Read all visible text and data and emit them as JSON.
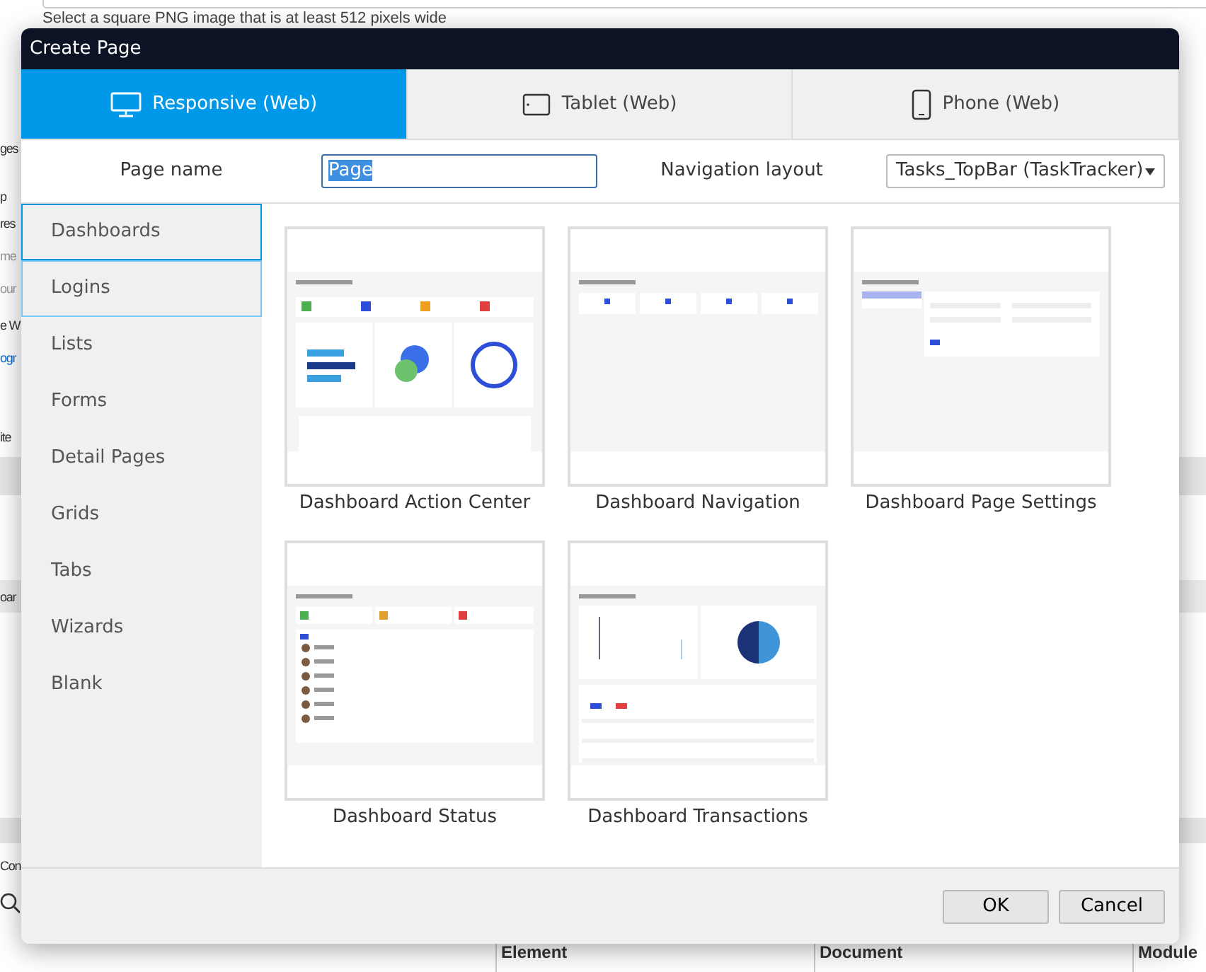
{
  "background": {
    "hint": "Select a square PNG image that is at least 512 pixels wide",
    "fragments": [
      {
        "text": "ges",
        "kind": "text"
      },
      {
        "text": "p",
        "kind": "text"
      },
      {
        "text": "res",
        "kind": "text"
      },
      {
        "text": "me",
        "kind": "muted"
      },
      {
        "text": "our",
        "kind": "muted"
      },
      {
        "text": "e W",
        "kind": "text"
      },
      {
        "text": "ogr",
        "kind": "link"
      },
      {
        "text": "ite",
        "kind": "text"
      },
      {
        "text": "oar",
        "kind": "text"
      },
      {
        "text": "Con",
        "kind": "text"
      }
    ],
    "columns": [
      "Element",
      "Document",
      "Module"
    ]
  },
  "dialog": {
    "title": "Create Page",
    "tabs": [
      {
        "label": "Responsive (Web)",
        "kind": "desktop",
        "selected": true
      },
      {
        "label": "Tablet (Web)",
        "kind": "tablet",
        "selected": false
      },
      {
        "label": "Phone (Web)",
        "kind": "phone",
        "selected": false
      }
    ],
    "form": {
      "page_name_label": "Page name",
      "page_name": {
        "value": "Page",
        "text_selected": true
      },
      "navigation_label": "Navigation layout",
      "navigation_layout": "Tasks_TopBar (TaskTracker)"
    },
    "categories": [
      {
        "label": "Dashboards",
        "selected": true,
        "hovered": false
      },
      {
        "label": "Logins",
        "selected": false,
        "hovered": true
      },
      {
        "label": "Lists",
        "selected": false,
        "hovered": false
      },
      {
        "label": "Forms",
        "selected": false,
        "hovered": false
      },
      {
        "label": "Detail Pages",
        "selected": false,
        "hovered": false
      },
      {
        "label": "Grids",
        "selected": false,
        "hovered": false
      },
      {
        "label": "Tabs",
        "selected": false,
        "hovered": false
      },
      {
        "label": "Wizards",
        "selected": false,
        "hovered": false
      },
      {
        "label": "Blank",
        "selected": false,
        "hovered": false
      }
    ],
    "templates": [
      {
        "name": "Dashboard Action Center",
        "kind": "action-center"
      },
      {
        "name": "Dashboard Navigation",
        "kind": "navigation"
      },
      {
        "name": "Dashboard Page Settings",
        "kind": "page-settings"
      },
      {
        "name": "Dashboard Status",
        "kind": "status"
      },
      {
        "name": "Dashboard Transactions",
        "kind": "transactions"
      }
    ],
    "buttons": [
      "OK",
      "Cancel"
    ]
  }
}
